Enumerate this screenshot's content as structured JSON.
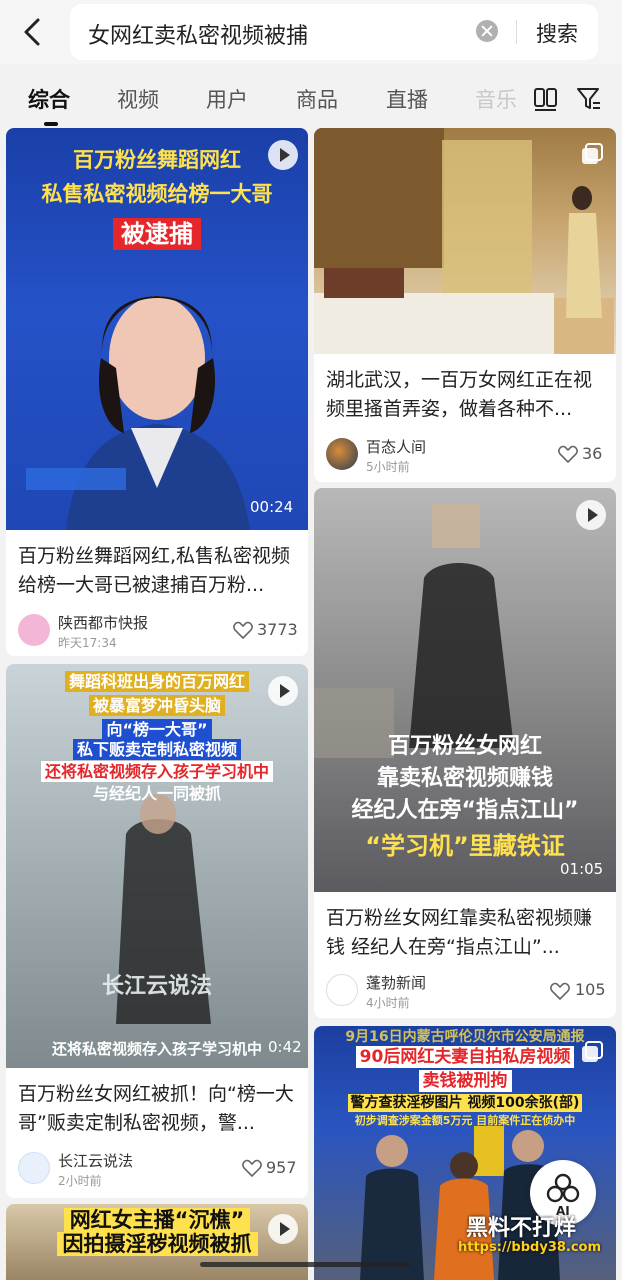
{
  "search": {
    "query": "女网红卖私密视频被捕",
    "button": "搜索"
  },
  "tabs": [
    "综合",
    "视频",
    "用户",
    "商品",
    "直播",
    "音乐"
  ],
  "cards": [
    {
      "overlay": [
        "百万粉丝舞蹈网红",
        "私售私密视频给榜一大哥",
        "被逮捕"
      ],
      "duration": "00:24",
      "title": "百万粉丝舞蹈网红,私售私密视频给榜一大哥已被逮捕百万粉...",
      "author": "陕西都市快报",
      "time": "昨天17:34",
      "likes": "3773"
    },
    {
      "title": "湖北武汉，一百万女网红正在视频里搔首弄姿，做着各种不...",
      "author": "百态人间",
      "time": "5小时前",
      "likes": "36"
    },
    {
      "overlay": [
        "百万粉丝女网红",
        "靠卖私密视频赚钱",
        "经纪人在旁“指点江山”",
        "“学习机”里藏铁证"
      ],
      "duration": "01:05",
      "title": "百万粉丝女网红靠卖私密视频赚钱 经纪人在旁“指点江山”...",
      "author": "蓬勃新闻",
      "time": "4小时前",
      "likes": "105"
    },
    {
      "overlay": [
        "舞蹈科班出身的百万网红",
        "被暴富梦冲昏头脑",
        "向“榜一大哥”",
        "私下贩卖定制私密视频",
        "还将私密视频存入孩子学习机中",
        "与经纪人一同被抓"
      ],
      "watermark_text": "长江云说法",
      "caption": "还将私密视频存入孩子学习机中",
      "duration": "0:42",
      "title": "百万粉丝女网红被抓！向“榜一大哥”贩卖定制私密视频，警...",
      "author": "长江云说法",
      "time": "2小时前",
      "likes": "957"
    },
    {
      "overlay": [
        "9月16日内蒙古呼伦贝尔市公安局通报",
        "90后网红夫妻自拍私房视频",
        "卖钱被刑拘",
        "警方查获淫秽图片 视频100余张(部)",
        "初步调查涉案金额5万元 目前案件正在侦办中"
      ]
    },
    {
      "overlay": [
        "网红女主播“沉樵”",
        "因拍摄淫秽视频被抓"
      ]
    }
  ],
  "ai_label": "AI",
  "watermark": {
    "brand": "黑料不打烊",
    "url": "https://bbdy38.com"
  },
  "colors": {
    "accent": "#111111",
    "overlay_yellow": "#ffe14d",
    "overlay_red": "#e5262a"
  }
}
